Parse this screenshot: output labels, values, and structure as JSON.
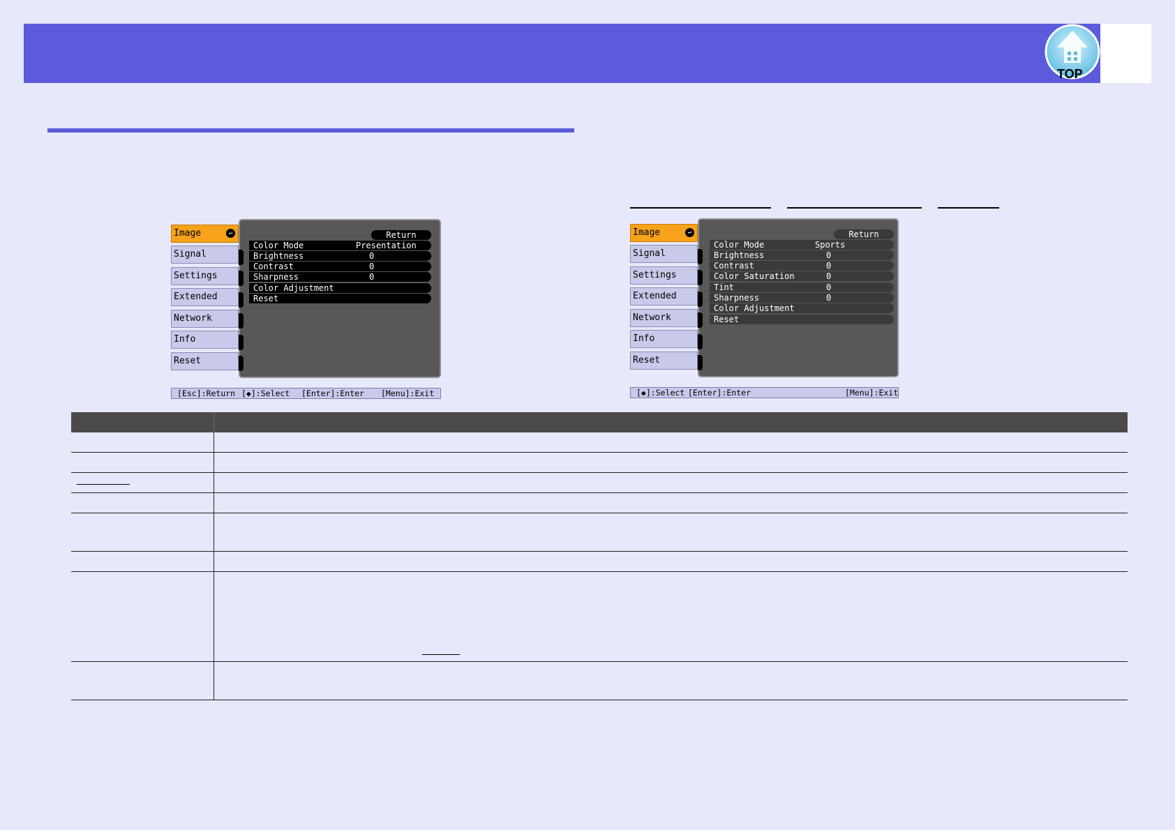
{
  "header": {
    "top_button_label": "TOP",
    "top_icon": "house-up-icon"
  },
  "menu_left": {
    "tabs": [
      {
        "label": "Image"
      },
      {
        "label": "Signal"
      },
      {
        "label": "Settings"
      },
      {
        "label": "Extended"
      },
      {
        "label": "Network"
      },
      {
        "label": "Info"
      },
      {
        "label": "Reset"
      }
    ],
    "return_label": "Return",
    "items": [
      {
        "label": "Color Mode",
        "value": "Presentation"
      },
      {
        "label": "Brightness",
        "value": "0"
      },
      {
        "label": "Contrast",
        "value": "0"
      },
      {
        "label": "Sharpness",
        "value": "0"
      },
      {
        "label": "Color Adjustment",
        "value": ""
      },
      {
        "label": "Reset",
        "value": ""
      }
    ],
    "status": {
      "esc": "[Esc]:Return",
      "select": "[◆]:Select",
      "enter": "[Enter]:Enter",
      "exit": "[Menu]:Exit"
    }
  },
  "menu_right": {
    "tabs": [
      {
        "label": "Image"
      },
      {
        "label": "Signal"
      },
      {
        "label": "Settings"
      },
      {
        "label": "Extended"
      },
      {
        "label": "Network"
      },
      {
        "label": "Info"
      },
      {
        "label": "Reset"
      }
    ],
    "return_label": "Return",
    "items": [
      {
        "label": "Color Mode",
        "value": "Sports"
      },
      {
        "label": "Brightness",
        "value": "0"
      },
      {
        "label": "Contrast",
        "value": "0"
      },
      {
        "label": "Color Saturation",
        "value": "0"
      },
      {
        "label": "Tint",
        "value": "0"
      },
      {
        "label": "Sharpness",
        "value": "0"
      },
      {
        "label": "Color Adjustment",
        "value": ""
      },
      {
        "label": "Reset",
        "value": ""
      }
    ],
    "status": {
      "select": "[◆]:Select",
      "enter": "[Enter]:Enter",
      "exit": "[Menu]:Exit"
    }
  },
  "colors": {
    "header": "#5b5bdb",
    "page_bg": "#e7e8fa",
    "active_tab": "#f7a21b",
    "tab": "#c9c9ea",
    "table_header": "#4a4a4a"
  }
}
